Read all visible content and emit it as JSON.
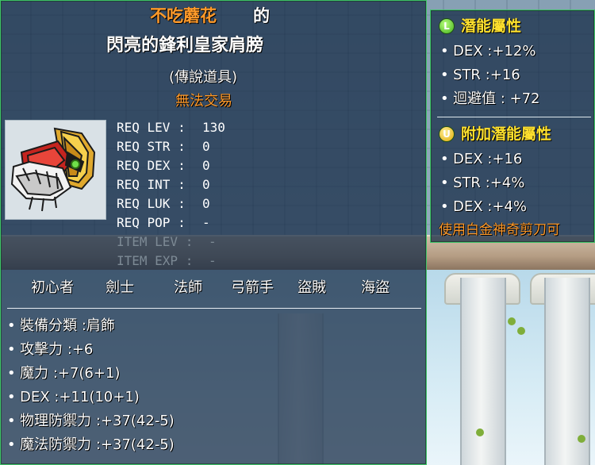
{
  "title": {
    "owner": "不吃蘑花",
    "owner_suffix": "的",
    "item_name": "閃亮的鋒利皇家肩膀",
    "rarity": "(傳說道具)",
    "trade_status": "無法交易"
  },
  "item_icon": "shoulder-armor-icon",
  "requirements": [
    {
      "label": "REQ LEV :",
      "value": "130",
      "dim": false
    },
    {
      "label": "REQ STR :",
      "value": "0",
      "dim": false
    },
    {
      "label": "REQ DEX :",
      "value": "0",
      "dim": false
    },
    {
      "label": "REQ INT :",
      "value": "0",
      "dim": false
    },
    {
      "label": "REQ LUK :",
      "value": "0",
      "dim": false
    },
    {
      "label": "REQ POP :",
      "value": "-",
      "dim": false
    },
    {
      "label": "ITEM LEV :",
      "value": "-",
      "dim": true
    },
    {
      "label": "ITEM EXP :",
      "value": "-",
      "dim": true
    }
  ],
  "jobs": [
    "初心者",
    "劍士",
    "法師",
    "弓箭手",
    "盜賊",
    "海盜"
  ],
  "stats": [
    "裝備分類 :肩飾",
    "攻擊力 :+6",
    "魔力 :+7(6+1)",
    "DEX :+11(10+1)",
    "物理防禦力 :+37(42-5)",
    "魔法防禦力 :+37(42-5)"
  ],
  "potential": {
    "badge": "L",
    "heading": "潛能屬性",
    "lines": [
      "DEX :+12%",
      "STR :+16",
      "迴避值 : +72"
    ]
  },
  "additional_potential": {
    "badge": "U",
    "heading": "附加潛能屬性",
    "lines": [
      "DEX :+16",
      "STR :+4%",
      "DEX :+4%"
    ]
  },
  "scissors_note": "使用白金神奇剪刀可",
  "colors": {
    "owner": "#ff9a2a",
    "untradable": "#ff9a2a",
    "potential_heading": "#ffe12e",
    "border": "#3fc36a",
    "panel_bg": "#162b46"
  }
}
